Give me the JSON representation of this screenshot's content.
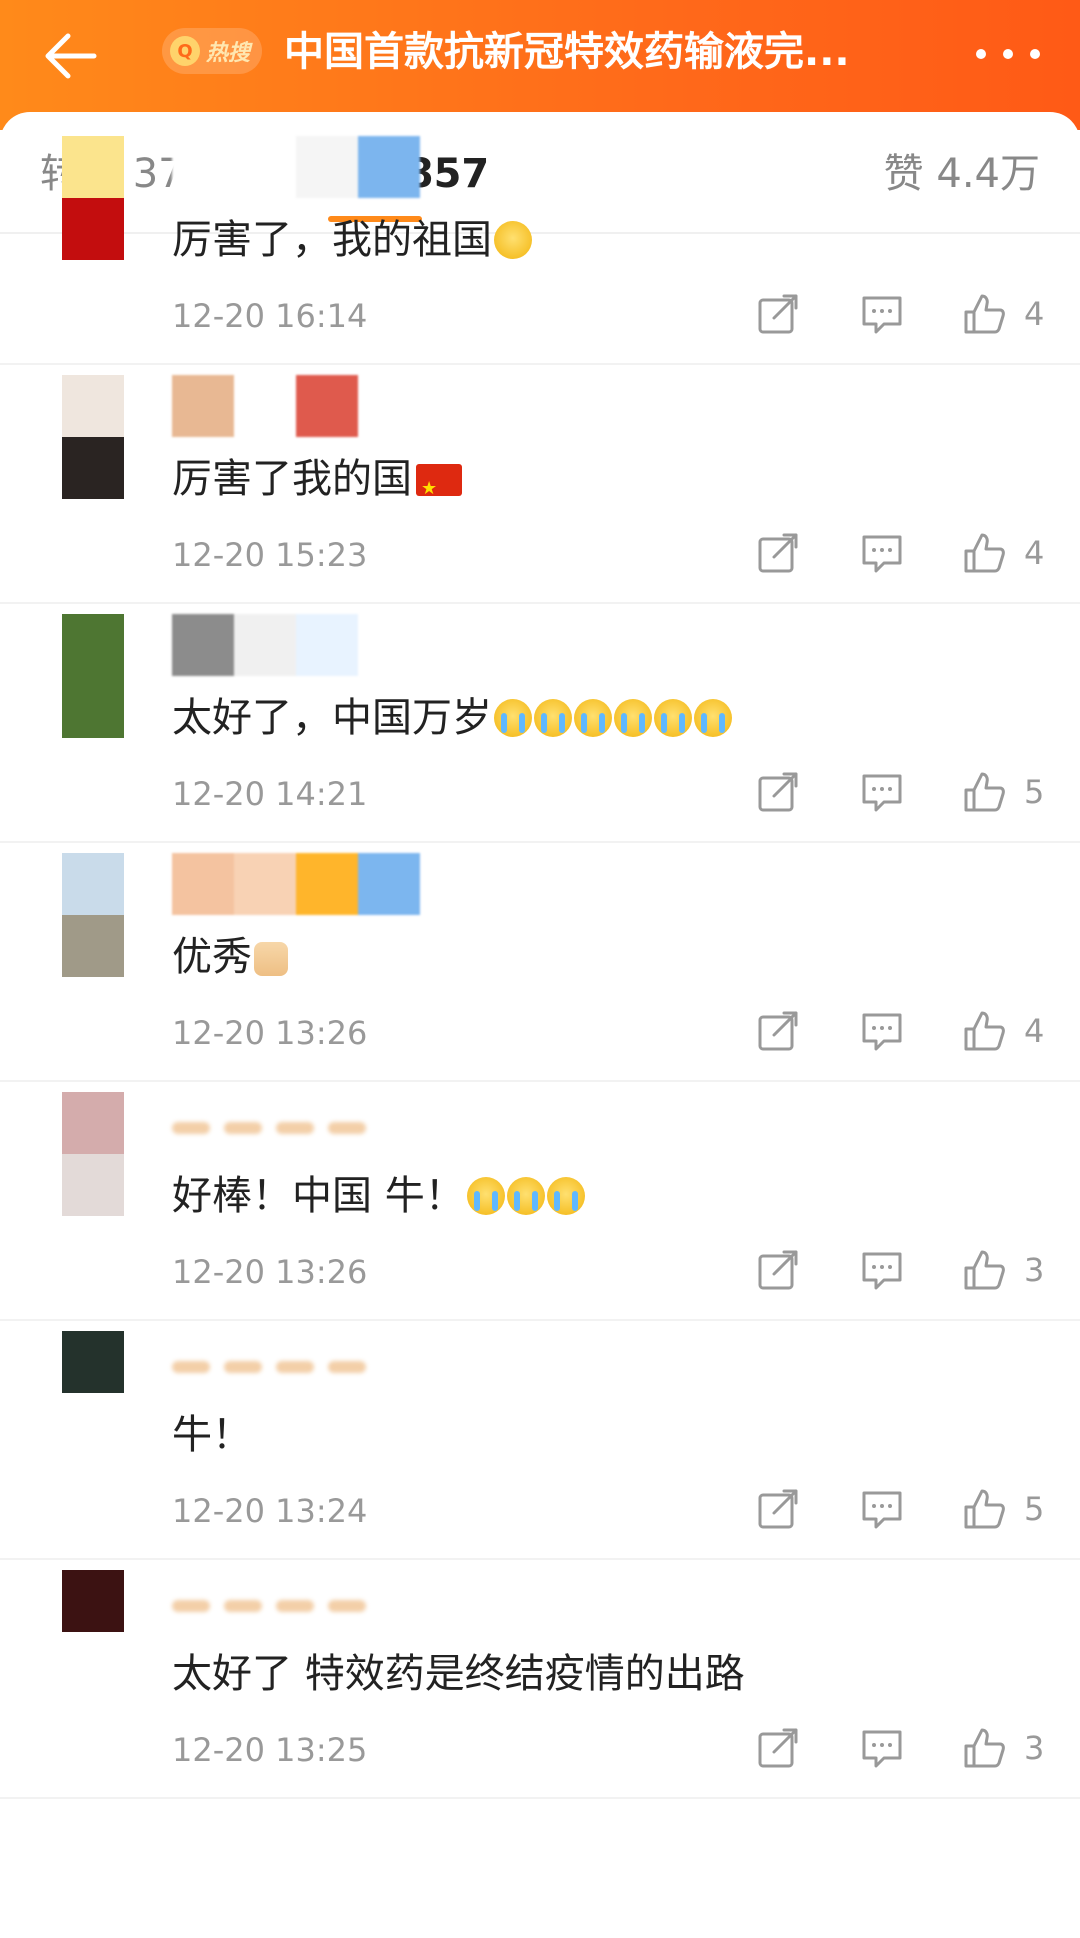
{
  "header": {
    "hot_badge_icon": "search-icon",
    "hot_badge_text": "热搜",
    "title": "中国首款抗新冠特效药输液完...",
    "back_icon": "arrow-left-icon",
    "more_icon": "more-dots-icon",
    "background": "#ff7a1a"
  },
  "tabs": {
    "repost": "转发 3726",
    "comments": "评论 2857",
    "likes": "赞 4.4万",
    "accent": "#ff8a1a"
  },
  "comments": [
    {
      "text": "厉害了，我的祖国",
      "emoji": "face-icon",
      "time": "12-20 16:14",
      "likes": "4",
      "avatar": [
        "#fbe48d",
        "#c30d0e"
      ],
      "name_blocks": [
        "#ffffff",
        "#ffffff",
        "#f5f5f5",
        "#7cb5ee"
      ]
    },
    {
      "text": "厉害了我的国",
      "emoji": "china-flag-icon",
      "time": "12-20 15:23",
      "likes": "4",
      "avatar": [
        "#efe6de",
        "#2a2422"
      ],
      "name_blocks": [
        "#e8b893",
        "#ffffff",
        "#df5a4d"
      ]
    },
    {
      "text": "太好了，中国万岁",
      "emoji": "crying-face-icon",
      "emoji_count": 6,
      "time": "12-20 14:21",
      "likes": "5",
      "avatar": [
        "#4e7632",
        "#4e7632"
      ],
      "name_blocks": [
        "#8c8c8c",
        "#f0f0f0",
        "#e8f3ff"
      ]
    },
    {
      "text": "优秀",
      "emoji": "thumbs-up-icon",
      "time": "12-20 13:26",
      "likes": "4",
      "avatar": [
        "#c9dbea",
        "#a09a88"
      ],
      "name_blocks": [
        "#f4c3a0",
        "#f8d2b4",
        "#ffb52b",
        "#7cb6ef"
      ]
    },
    {
      "text": "好棒！中国 牛！",
      "emoji": "crying-face-icon",
      "emoji_count": 3,
      "time": "12-20 13:26",
      "likes": "3",
      "avatar": [
        "#d4acac",
        "#e3dad8"
      ],
      "name_blocks": []
    },
    {
      "text": "牛！",
      "emoji": "",
      "time": "12-20 13:24",
      "likes": "5",
      "avatar": [
        "#24322c",
        "#ffffff"
      ],
      "name_blocks": []
    },
    {
      "text": "太好了 特效药是终结疫情的出路",
      "emoji": "",
      "time": "12-20 13:25",
      "likes": "3",
      "avatar": [
        "#3c1212",
        "#ffffff"
      ],
      "name_blocks": []
    }
  ]
}
